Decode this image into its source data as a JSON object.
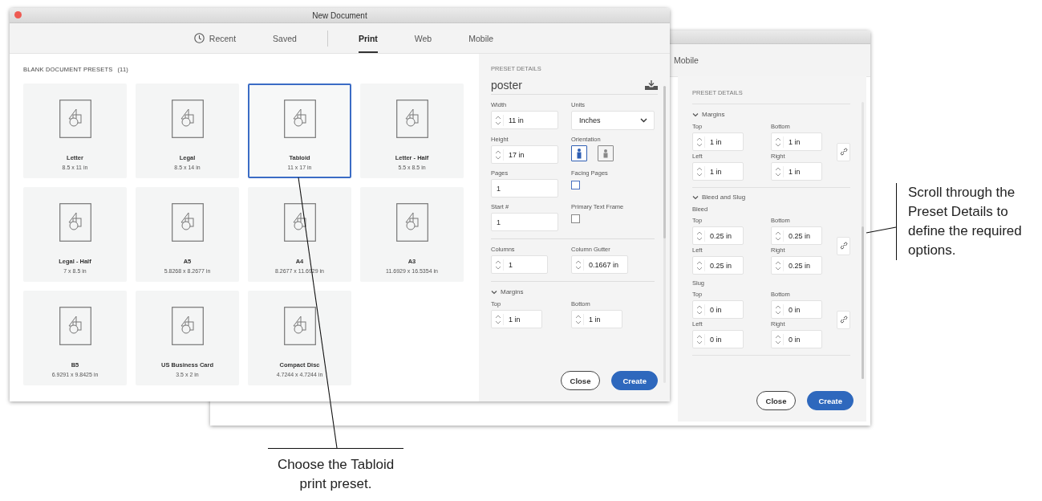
{
  "front_window": {
    "title": "New Document",
    "tab_groups": [
      [
        {
          "label": "Recent",
          "selected": false,
          "kind": "history"
        },
        {
          "label": "Saved",
          "selected": false,
          "kind": "plain"
        }
      ],
      [
        {
          "label": "Print",
          "selected": true,
          "kind": "plain"
        },
        {
          "label": "Web",
          "selected": false,
          "kind": "plain"
        },
        {
          "label": "Mobile",
          "selected": false,
          "kind": "plain"
        }
      ]
    ],
    "presets_heading": "BLANK DOCUMENT PRESETS",
    "presets_count": "(11)",
    "presets": [
      {
        "name": "Letter",
        "size": "8.5 x 11 in",
        "selected": false
      },
      {
        "name": "Legal",
        "size": "8.5 x 14 in",
        "selected": false
      },
      {
        "name": "Tabloid",
        "size": "11 x 17 in",
        "selected": true
      },
      {
        "name": "Letter - Half",
        "size": "5.5 x 8.5 in",
        "selected": false
      },
      {
        "name": "Legal - Half",
        "size": "7 x 8.5 in",
        "selected": false
      },
      {
        "name": "A5",
        "size": "5.8268 x 8.2677 in",
        "selected": false
      },
      {
        "name": "A4",
        "size": "8.2677 x 11.6929 in",
        "selected": false
      },
      {
        "name": "A3",
        "size": "11.6929 x 16.5354 in",
        "selected": false
      },
      {
        "name": "B5",
        "size": "6.9291 x 9.8425 in",
        "selected": false
      },
      {
        "name": "US Business Card",
        "size": "3.5 x 2 in",
        "selected": false
      },
      {
        "name": "Compact Disc",
        "size": "4.7244 x 4.7244 in",
        "selected": false
      }
    ],
    "details": {
      "heading": "PRESET DETAILS",
      "name": "poster",
      "width": {
        "label": "Width",
        "value": "11 in"
      },
      "units": {
        "label": "Units",
        "value": "Inches"
      },
      "height": {
        "label": "Height",
        "value": "17 in"
      },
      "orientation": {
        "label": "Orientation",
        "options": [
          {
            "kind": "portrait",
            "selected": true
          },
          {
            "kind": "landscape",
            "selected": false
          }
        ]
      },
      "pages": {
        "label": "Pages",
        "value": "1"
      },
      "facing_pages": {
        "label": "Facing Pages",
        "checked": false
      },
      "start": {
        "label": "Start #",
        "value": "1"
      },
      "primary_text_frame": {
        "label": "Primary Text Frame",
        "checked": false
      },
      "columns": {
        "label": "Columns",
        "value": "1"
      },
      "column_gutter": {
        "label": "Column Gutter",
        "value": "0.1667 in"
      },
      "margins": {
        "title": "Margins",
        "expanded": true,
        "top": {
          "label": "Top",
          "value": "1 in"
        },
        "bottom": {
          "label": "Bottom",
          "value": "1 in"
        }
      }
    },
    "buttons": [
      {
        "label": "Close",
        "kind": "secondary"
      },
      {
        "label": "Create",
        "kind": "primary"
      }
    ]
  },
  "back_window": {
    "tabs": [
      {
        "label": "Mobile",
        "selected": false
      }
    ],
    "details_heading": "PRESET DETAILS",
    "sections": [
      {
        "title": "Margins",
        "expanded": true,
        "groups": [
          {
            "fields": [
              {
                "label": "Top",
                "value": "1 in"
              },
              {
                "label": "Bottom",
                "value": "1 in"
              },
              {
                "label": "Left",
                "value": "1 in"
              },
              {
                "label": "Right",
                "value": "1 in"
              }
            ]
          }
        ]
      },
      {
        "title": "Bleed and Slug",
        "expanded": true,
        "groups": [
          {
            "label": "Bleed",
            "fields": [
              {
                "label": "Top",
                "value": "0.25 in"
              },
              {
                "label": "Bottom",
                "value": "0.25 in"
              },
              {
                "label": "Left",
                "value": "0.25 in"
              },
              {
                "label": "Right",
                "value": "0.25 in"
              }
            ]
          },
          {
            "label": "Slug",
            "fields": [
              {
                "label": "Top",
                "value": "0 in"
              },
              {
                "label": "Bottom",
                "value": "0 in"
              },
              {
                "label": "Left",
                "value": "0 in"
              },
              {
                "label": "Right",
                "value": "0 in"
              }
            ]
          }
        ]
      }
    ],
    "buttons": [
      {
        "label": "Close",
        "kind": "secondary"
      },
      {
        "label": "Create",
        "kind": "primary"
      }
    ]
  },
  "callouts": [
    {
      "text": "Choose the Tabloid print preset."
    },
    {
      "text": "Scroll through the Preset Details to define the required options."
    }
  ]
}
